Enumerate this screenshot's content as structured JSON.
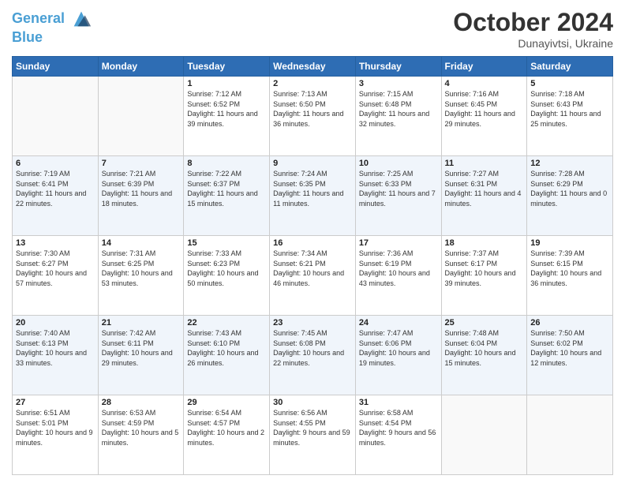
{
  "header": {
    "logo_line1": "General",
    "logo_line2": "Blue",
    "month": "October 2024",
    "location": "Dunayivtsi, Ukraine"
  },
  "days_of_week": [
    "Sunday",
    "Monday",
    "Tuesday",
    "Wednesday",
    "Thursday",
    "Friday",
    "Saturday"
  ],
  "weeks": [
    [
      {
        "day": "",
        "info": ""
      },
      {
        "day": "",
        "info": ""
      },
      {
        "day": "1",
        "info": "Sunrise: 7:12 AM\nSunset: 6:52 PM\nDaylight: 11 hours and 39 minutes."
      },
      {
        "day": "2",
        "info": "Sunrise: 7:13 AM\nSunset: 6:50 PM\nDaylight: 11 hours and 36 minutes."
      },
      {
        "day": "3",
        "info": "Sunrise: 7:15 AM\nSunset: 6:48 PM\nDaylight: 11 hours and 32 minutes."
      },
      {
        "day": "4",
        "info": "Sunrise: 7:16 AM\nSunset: 6:45 PM\nDaylight: 11 hours and 29 minutes."
      },
      {
        "day": "5",
        "info": "Sunrise: 7:18 AM\nSunset: 6:43 PM\nDaylight: 11 hours and 25 minutes."
      }
    ],
    [
      {
        "day": "6",
        "info": "Sunrise: 7:19 AM\nSunset: 6:41 PM\nDaylight: 11 hours and 22 minutes."
      },
      {
        "day": "7",
        "info": "Sunrise: 7:21 AM\nSunset: 6:39 PM\nDaylight: 11 hours and 18 minutes."
      },
      {
        "day": "8",
        "info": "Sunrise: 7:22 AM\nSunset: 6:37 PM\nDaylight: 11 hours and 15 minutes."
      },
      {
        "day": "9",
        "info": "Sunrise: 7:24 AM\nSunset: 6:35 PM\nDaylight: 11 hours and 11 minutes."
      },
      {
        "day": "10",
        "info": "Sunrise: 7:25 AM\nSunset: 6:33 PM\nDaylight: 11 hours and 7 minutes."
      },
      {
        "day": "11",
        "info": "Sunrise: 7:27 AM\nSunset: 6:31 PM\nDaylight: 11 hours and 4 minutes."
      },
      {
        "day": "12",
        "info": "Sunrise: 7:28 AM\nSunset: 6:29 PM\nDaylight: 11 hours and 0 minutes."
      }
    ],
    [
      {
        "day": "13",
        "info": "Sunrise: 7:30 AM\nSunset: 6:27 PM\nDaylight: 10 hours and 57 minutes."
      },
      {
        "day": "14",
        "info": "Sunrise: 7:31 AM\nSunset: 6:25 PM\nDaylight: 10 hours and 53 minutes."
      },
      {
        "day": "15",
        "info": "Sunrise: 7:33 AM\nSunset: 6:23 PM\nDaylight: 10 hours and 50 minutes."
      },
      {
        "day": "16",
        "info": "Sunrise: 7:34 AM\nSunset: 6:21 PM\nDaylight: 10 hours and 46 minutes."
      },
      {
        "day": "17",
        "info": "Sunrise: 7:36 AM\nSunset: 6:19 PM\nDaylight: 10 hours and 43 minutes."
      },
      {
        "day": "18",
        "info": "Sunrise: 7:37 AM\nSunset: 6:17 PM\nDaylight: 10 hours and 39 minutes."
      },
      {
        "day": "19",
        "info": "Sunrise: 7:39 AM\nSunset: 6:15 PM\nDaylight: 10 hours and 36 minutes."
      }
    ],
    [
      {
        "day": "20",
        "info": "Sunrise: 7:40 AM\nSunset: 6:13 PM\nDaylight: 10 hours and 33 minutes."
      },
      {
        "day": "21",
        "info": "Sunrise: 7:42 AM\nSunset: 6:11 PM\nDaylight: 10 hours and 29 minutes."
      },
      {
        "day": "22",
        "info": "Sunrise: 7:43 AM\nSunset: 6:10 PM\nDaylight: 10 hours and 26 minutes."
      },
      {
        "day": "23",
        "info": "Sunrise: 7:45 AM\nSunset: 6:08 PM\nDaylight: 10 hours and 22 minutes."
      },
      {
        "day": "24",
        "info": "Sunrise: 7:47 AM\nSunset: 6:06 PM\nDaylight: 10 hours and 19 minutes."
      },
      {
        "day": "25",
        "info": "Sunrise: 7:48 AM\nSunset: 6:04 PM\nDaylight: 10 hours and 15 minutes."
      },
      {
        "day": "26",
        "info": "Sunrise: 7:50 AM\nSunset: 6:02 PM\nDaylight: 10 hours and 12 minutes."
      }
    ],
    [
      {
        "day": "27",
        "info": "Sunrise: 6:51 AM\nSunset: 5:01 PM\nDaylight: 10 hours and 9 minutes."
      },
      {
        "day": "28",
        "info": "Sunrise: 6:53 AM\nSunset: 4:59 PM\nDaylight: 10 hours and 5 minutes."
      },
      {
        "day": "29",
        "info": "Sunrise: 6:54 AM\nSunset: 4:57 PM\nDaylight: 10 hours and 2 minutes."
      },
      {
        "day": "30",
        "info": "Sunrise: 6:56 AM\nSunset: 4:55 PM\nDaylight: 9 hours and 59 minutes."
      },
      {
        "day": "31",
        "info": "Sunrise: 6:58 AM\nSunset: 4:54 PM\nDaylight: 9 hours and 56 minutes."
      },
      {
        "day": "",
        "info": ""
      },
      {
        "day": "",
        "info": ""
      }
    ]
  ]
}
